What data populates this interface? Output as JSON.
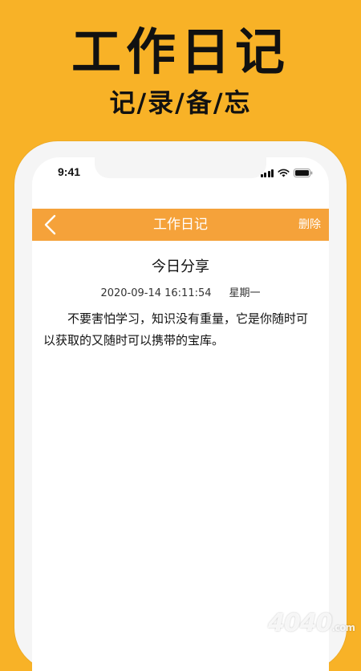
{
  "promo": {
    "title": "工作日记",
    "subtitle": "记/录/备/忘"
  },
  "status_bar": {
    "time": "9:41",
    "icons": [
      "signal-icon",
      "wifi-icon",
      "battery-icon"
    ]
  },
  "nav": {
    "title": "工作日记",
    "back_icon": "chevron-left-icon",
    "delete_label": "删除"
  },
  "entry": {
    "title": "今日分享",
    "datetime": "2020-09-14 16:11:54",
    "weekday": "星期一",
    "body": "不要害怕学习，知识没有重量，它是你随时可以获取的又随时可以携带的宝库。"
  },
  "watermark": {
    "text": "4040",
    "suffix": ".com"
  },
  "colors": {
    "background": "#f8b227",
    "nav_bar": "#f5a23a",
    "text": "#111111"
  }
}
